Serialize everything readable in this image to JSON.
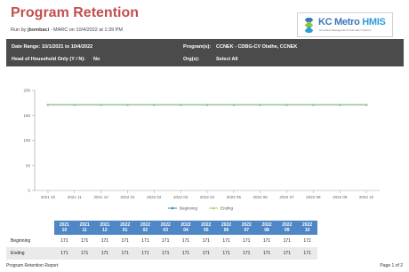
{
  "report": {
    "title": "Program Retention",
    "run_by_prefix": "Run by ",
    "run_by_user": "jbombaci",
    "run_by_suffix": " - MARC on 10/4/2022 at 1:39 PM"
  },
  "logo": {
    "name_main": "KC Metro ",
    "name_hmis": "HMIS",
    "subtitle": "Homeless Management Information System",
    "icon": "kc-metro-logo-icon",
    "colors": {
      "primary": "#3a76b8",
      "accent": "#2c9fd6"
    }
  },
  "filters": {
    "date_range_label": "Date Range:",
    "date_range_value": "10/1/2021 to 10/4/2022",
    "hoh_label": "Head of Household Only (Y / N):",
    "hoh_value": "No",
    "programs_label": "Program(s):",
    "programs_value": "CCNEK - CDBG-CV Olathe, CCNEK",
    "orgs_label": "Org(s):",
    "orgs_value": "Select All"
  },
  "chart_data": {
    "type": "line",
    "x": [
      "2021 10",
      "2021 11",
      "2021 12",
      "2022 01",
      "2022 02",
      "2022 03",
      "2022 04",
      "2022 05",
      "2022 06",
      "2022 07",
      "2022 08",
      "2022 09",
      "2022 10"
    ],
    "series": [
      {
        "name": "Beginning",
        "values": [
          171,
          171,
          171,
          171,
          171,
          171,
          171,
          171,
          171,
          171,
          171,
          171,
          171
        ],
        "color": "#2e86c1"
      },
      {
        "name": "Ending",
        "values": [
          171,
          171,
          171,
          171,
          171,
          171,
          171,
          171,
          171,
          171,
          171,
          171,
          171
        ],
        "color": "#9bd56b"
      }
    ],
    "ylim": [
      0,
      200
    ],
    "yticks": [
      0,
      50,
      100,
      150,
      200
    ],
    "ytick_labels": [
      "0",
      "50",
      "100",
      "150",
      "200"
    ],
    "grid": false,
    "legend": "bottom-center"
  },
  "table": {
    "headers": [
      "2021\n10",
      "2021\n11",
      "2021\n12",
      "2022\n01",
      "2022\n02",
      "2022\n03",
      "2022\n04",
      "2022\n05",
      "2022\n06",
      "2022\n07",
      "2022\n08",
      "2022\n09",
      "2022\n10"
    ],
    "rows": [
      {
        "label": "Beginning",
        "values": [
          "171",
          "171",
          "171",
          "171",
          "171",
          "171",
          "171",
          "171",
          "171",
          "171",
          "171",
          "171",
          "171"
        ]
      },
      {
        "label": "Ending",
        "values": [
          "171",
          "171",
          "171",
          "171",
          "171",
          "171",
          "171",
          "171",
          "171",
          "171",
          "171",
          "171",
          "171"
        ]
      }
    ]
  },
  "footer": {
    "report_name": "Program Retention Report",
    "page": "Page 1 of 2"
  }
}
